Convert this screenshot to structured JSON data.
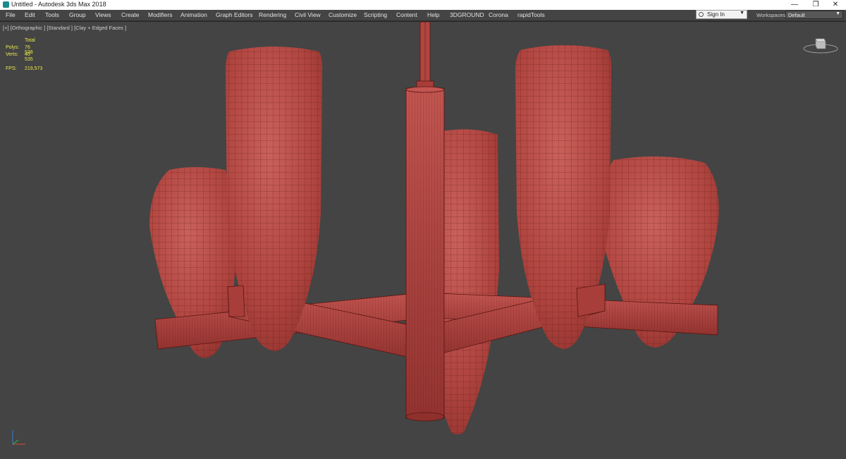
{
  "window": {
    "title": "Untitled - Autodesk 3ds Max 2018",
    "minimize_glyph": "—",
    "maximize_glyph": "❐",
    "close_glyph": "✕"
  },
  "menu": [
    {
      "label": "File"
    },
    {
      "label": "Edit"
    },
    {
      "label": "Tools"
    },
    {
      "label": "Group"
    },
    {
      "label": "Views"
    },
    {
      "label": "Create"
    },
    {
      "label": "Modifiers"
    },
    {
      "label": "Animation"
    },
    {
      "label": "Graph Editors"
    },
    {
      "label": "Rendering"
    },
    {
      "label": "Civil View"
    },
    {
      "label": "Customize"
    },
    {
      "label": "Scripting"
    },
    {
      "label": "Content"
    },
    {
      "label": "Help"
    },
    {
      "label": "3DGROUND"
    },
    {
      "label": "Corona"
    },
    {
      "label": "rapidTools"
    }
  ],
  "account": {
    "signin_label": "Sign In"
  },
  "workspace": {
    "label": "Workspaces:",
    "value": "Default"
  },
  "viewport": {
    "label": "[+] [Orthographic ] [Standard ] [Clay + Edged Faces ]",
    "stats": {
      "header": "Total",
      "polys_label": "Polys:",
      "polys_value": "76 538",
      "verts_label": "Verts:",
      "verts_value": "40 535",
      "fps_label": "FPS:",
      "fps_value": "219,573"
    },
    "background_color": "#444444",
    "model_color": "#b84a44",
    "wire_color": "#5a1512"
  }
}
